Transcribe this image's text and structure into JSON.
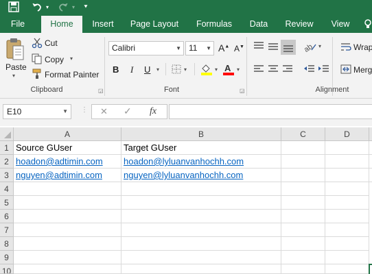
{
  "quick_access": {
    "save_icon": "save-icon",
    "undo_icon": "undo-icon",
    "redo_icon": "redo-icon",
    "customize_icon": "customize-icon"
  },
  "tabs": [
    "File",
    "Home",
    "Insert",
    "Page Layout",
    "Formulas",
    "Data",
    "Review",
    "View"
  ],
  "active_tab": "Home",
  "clipboard": {
    "paste_label": "Paste",
    "cut_label": "Cut",
    "copy_label": "Copy",
    "format_painter_label": "Format Painter",
    "group_label": "Clipboard"
  },
  "font": {
    "font_name": "Calibri",
    "font_size": "11",
    "bold": "B",
    "italic": "I",
    "underline": "U",
    "group_label": "Font",
    "increase_size": "A",
    "decrease_size": "A"
  },
  "alignment": {
    "wrap_label": "Wrap",
    "merge_label": "Merg",
    "group_label": "Alignment"
  },
  "formula_bar": {
    "name_box": "E10",
    "cancel_symbol": "✕",
    "enter_symbol": "✓",
    "fx_symbol": "fx",
    "formula": ""
  },
  "sheet": {
    "columns": [
      "A",
      "B",
      "C",
      "D"
    ],
    "rows": [
      "1",
      "2",
      "3",
      "4",
      "5",
      "6",
      "7",
      "8",
      "9",
      "10"
    ],
    "cells": {
      "A1": "Source GUser",
      "B1": "Target GUser",
      "A2": "hoadon@adtimin.com",
      "B2": "hoadon@lyluanvanhochh.com",
      "A3": "nguyen@adtimin.com",
      "B3": "nguyen@lyluanvanhochh.com"
    }
  },
  "colors": {
    "accent": "#217346",
    "link": "#0563c1"
  }
}
